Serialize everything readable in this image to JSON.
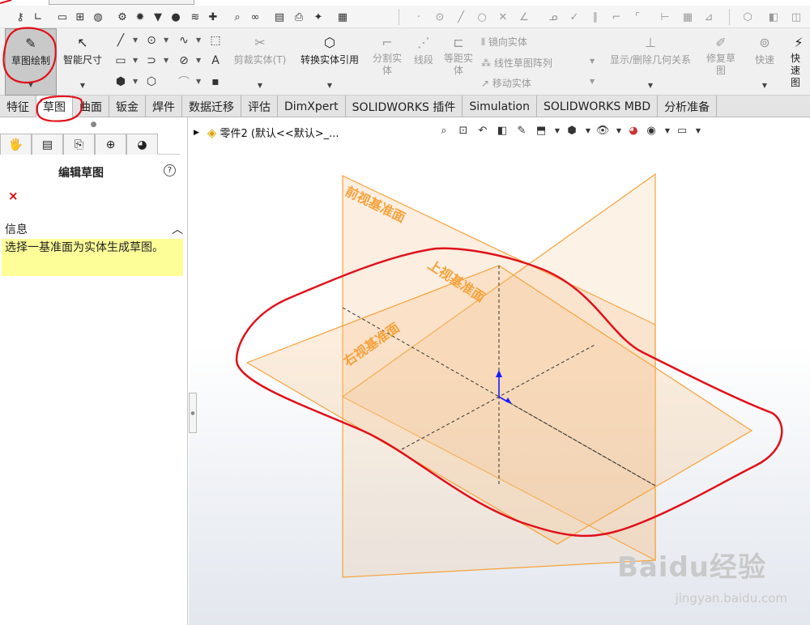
{
  "command_manager": {
    "sketch_label": "草图绘制",
    "smart_dim_label": "智能尺寸",
    "trim_label": "剪裁实体(T)",
    "convert_label": "转换实体引用",
    "split_label": "分割实体",
    "segment_label": "线段",
    "offset_label": "等距实体",
    "mirror_label": "镜向实体",
    "linear_pattern_label": "线性草图阵列",
    "move_label": "移动实体",
    "relations_label": "显示/删除几何关系",
    "repair_label": "修复草图",
    "quick_snap_label": "快速",
    "quick_view_label": "快速图"
  },
  "tabs": [
    {
      "label": "特征"
    },
    {
      "label": "草图"
    },
    {
      "label": "曲面"
    },
    {
      "label": "钣金"
    },
    {
      "label": "焊件"
    },
    {
      "label": "数据迁移"
    },
    {
      "label": "评估"
    },
    {
      "label": "DimXpert"
    },
    {
      "label": "SOLIDWORKS 插件"
    },
    {
      "label": "Simulation"
    },
    {
      "label": "SOLIDWORKS MBD"
    },
    {
      "label": "分析准备"
    }
  ],
  "property_manager": {
    "title": "编辑草图",
    "help": "?",
    "close": "×",
    "info_header": "信息",
    "info_text": "选择一基准面为实体生成草图。"
  },
  "viewport": {
    "tree_label": "零件2 (默认<<默认>_...",
    "front_plane_label": "前视基准面",
    "top_plane_label": "上视基准面",
    "right_plane_label": "右视基准面",
    "watermark": "Baidu经验",
    "watermark_url": "jingyan.baidu.com"
  },
  "colors": {
    "plane_edge": "#f7a23b",
    "plane_fill": "#f6c28e",
    "annotation_red": "#e0101a",
    "axis_blue": "#1a1aff",
    "info_yellow": "#fefe99"
  }
}
